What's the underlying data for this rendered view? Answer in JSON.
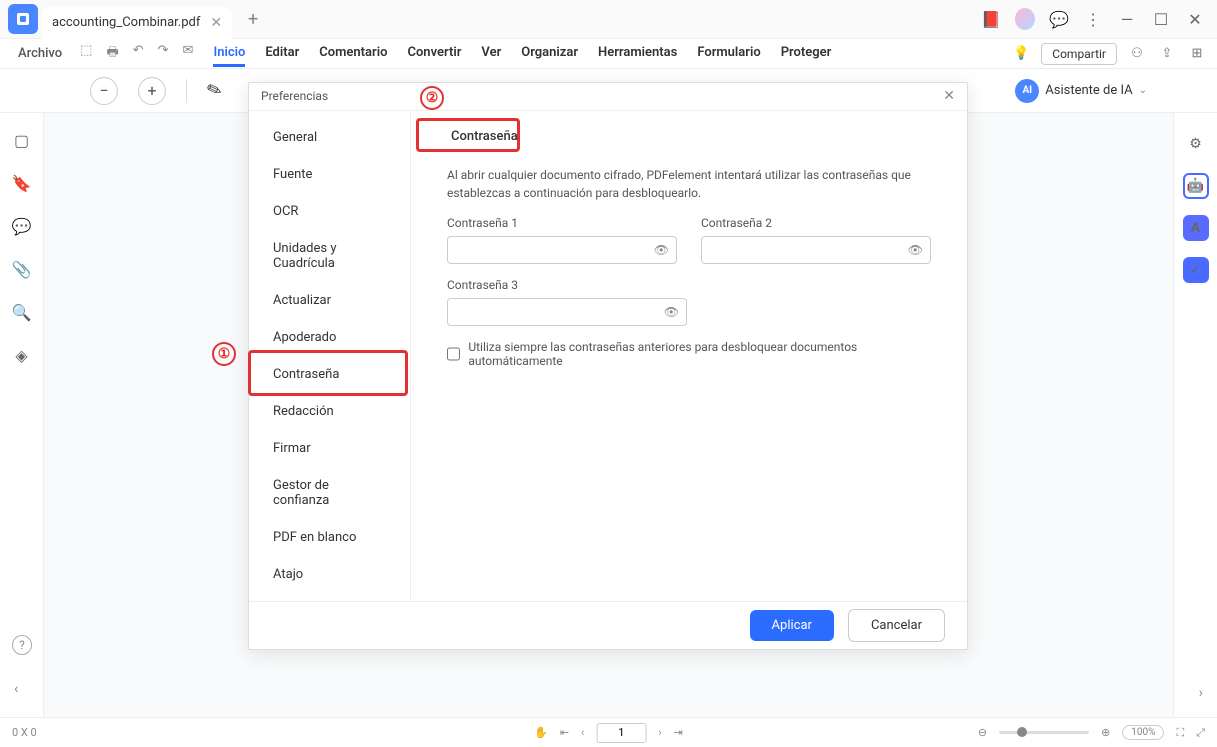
{
  "titlebar": {
    "tab_title": "accounting_Combinar.pdf"
  },
  "menubar": {
    "archivo": "Archivo"
  },
  "ribbon": {
    "inicio": "Inicio",
    "editar": "Editar",
    "comentario": "Comentario",
    "convertir": "Convertir",
    "ver": "Ver",
    "organizar": "Organizar",
    "herramientas": "Herramientas",
    "formulario": "Formulario",
    "proteger": "Proteger"
  },
  "share": {
    "label": "Compartir"
  },
  "ai_assistant": {
    "label": "Asistente de IA",
    "badge": "AI"
  },
  "dialog": {
    "title": "Preferencias",
    "sidebar": {
      "general": "General",
      "fuente": "Fuente",
      "ocr": "OCR",
      "unidades": "Unidades y Cuadrícula",
      "actualizar": "Actualizar",
      "apoderado": "Apoderado",
      "contrasena": "Contraseña",
      "redaccion": "Redacción",
      "firmar": "Firmar",
      "gestor": "Gestor de confianza",
      "pdf_blanco": "PDF en blanco",
      "atajo": "Atajo"
    },
    "content": {
      "section_title": "Contraseña",
      "description": "Al abrir cualquier documento cifrado, PDFelement intentará utilizar las contraseñas que establezcas a continuación para desbloquearlo.",
      "pw1_label": "Contraseña 1",
      "pw2_label": "Contraseña 2",
      "pw3_label": "Contraseña 3",
      "checkbox_label": "Utiliza siempre las contraseñas anteriores para desbloquear documentos automáticamente"
    },
    "footer": {
      "apply": "Aplicar",
      "cancel": "Cancelar"
    }
  },
  "annotations": {
    "one": "①",
    "two": "②"
  },
  "statusbar": {
    "size": "0 X 0",
    "page": "1",
    "zoom": "100%"
  }
}
